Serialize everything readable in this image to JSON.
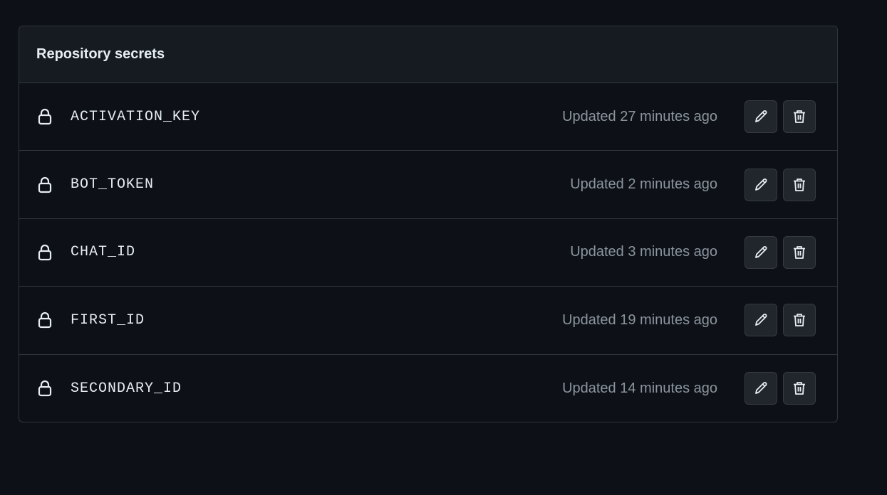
{
  "panel": {
    "title": "Repository secrets"
  },
  "secrets": [
    {
      "name": "ACTIVATION_KEY",
      "updated": "Updated 27 minutes ago"
    },
    {
      "name": "BOT_TOKEN",
      "updated": "Updated 2 minutes ago"
    },
    {
      "name": "CHAT_ID",
      "updated": "Updated 3 minutes ago"
    },
    {
      "name": "FIRST_ID",
      "updated": "Updated 19 minutes ago"
    },
    {
      "name": "SECONDARY_ID",
      "updated": "Updated 14 minutes ago"
    }
  ],
  "icons": {
    "lock": "lock-icon",
    "edit": "pencil-icon",
    "delete": "trash-icon"
  },
  "colors": {
    "background": "#0d1117",
    "header_background": "#161b22",
    "border": "#30363d",
    "button_background": "#21262d",
    "text_primary": "#e6edf3",
    "text_muted": "#8b949e"
  }
}
